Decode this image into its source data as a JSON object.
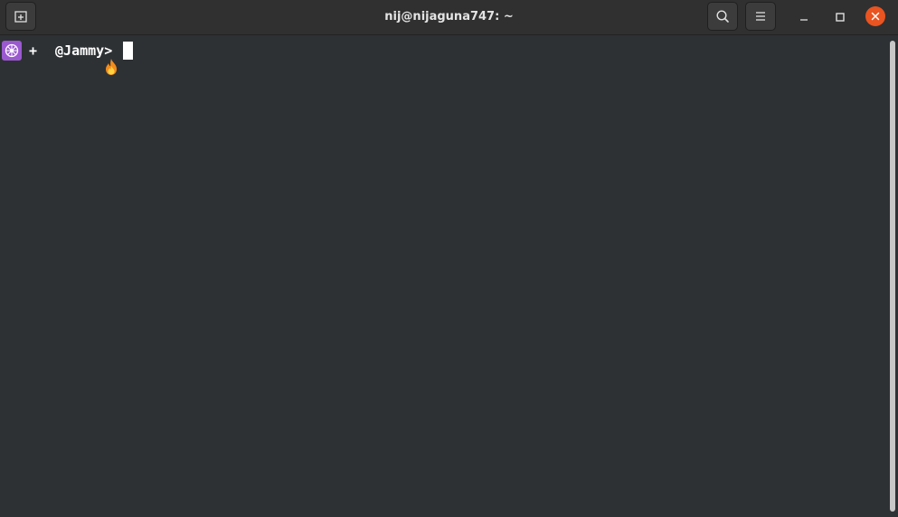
{
  "window": {
    "title": "nij@nijaguna747: ~"
  },
  "header": {
    "new_tab_icon": "new-tab-icon",
    "search_icon": "search-icon",
    "menu_icon": "hamburger-menu-icon",
    "minimize_icon": "minimize-icon",
    "maximize_icon": "maximize-icon",
    "close_icon": "close-icon",
    "close_color": "#e95420"
  },
  "terminal": {
    "background": "#2d3134",
    "prompt": {
      "context_icon": "kubernetes-icon",
      "context_icon_color": "#9b59d0",
      "plus": "+",
      "fire_icon": "fire-icon",
      "text": "@Jammy>"
    }
  }
}
